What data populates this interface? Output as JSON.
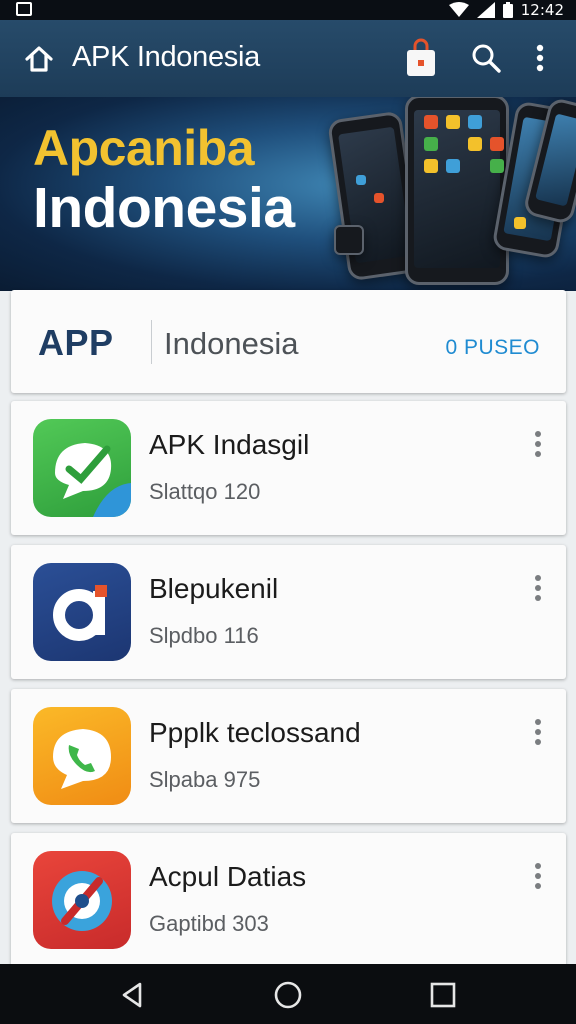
{
  "status_bar": {
    "time": "12:42"
  },
  "toolbar": {
    "title": "APK Indonesia",
    "icons": [
      "home-icon",
      "shopping-bag-icon",
      "search-icon",
      "more-vert-icon"
    ]
  },
  "banner": {
    "line1": "Apcaniba",
    "line2": "Indonesia"
  },
  "search_card": {
    "brand": "APP",
    "label": "Indonesia",
    "action": "0 PUSEO"
  },
  "apps": [
    {
      "name": "APK Indasgil",
      "subtitle": "Slattqo 120",
      "icon": "chat-check-icon",
      "color": "#3fb74a"
    },
    {
      "name": "Blepukenil",
      "subtitle": "Slpdbo 116",
      "icon": "a-letter-icon",
      "color": "#24448a"
    },
    {
      "name": "Ppplk teclossand",
      "subtitle": "Slpaba 975",
      "icon": "phone-bubble-icon",
      "color": "#f6a11c"
    },
    {
      "name": "Acpul Datias",
      "subtitle": "Gaptibd 303",
      "icon": "compass-icon",
      "color": "#e03a35"
    }
  ],
  "nav_bar": {
    "icons": [
      "back-icon",
      "home-circle-icon",
      "recents-icon"
    ]
  }
}
